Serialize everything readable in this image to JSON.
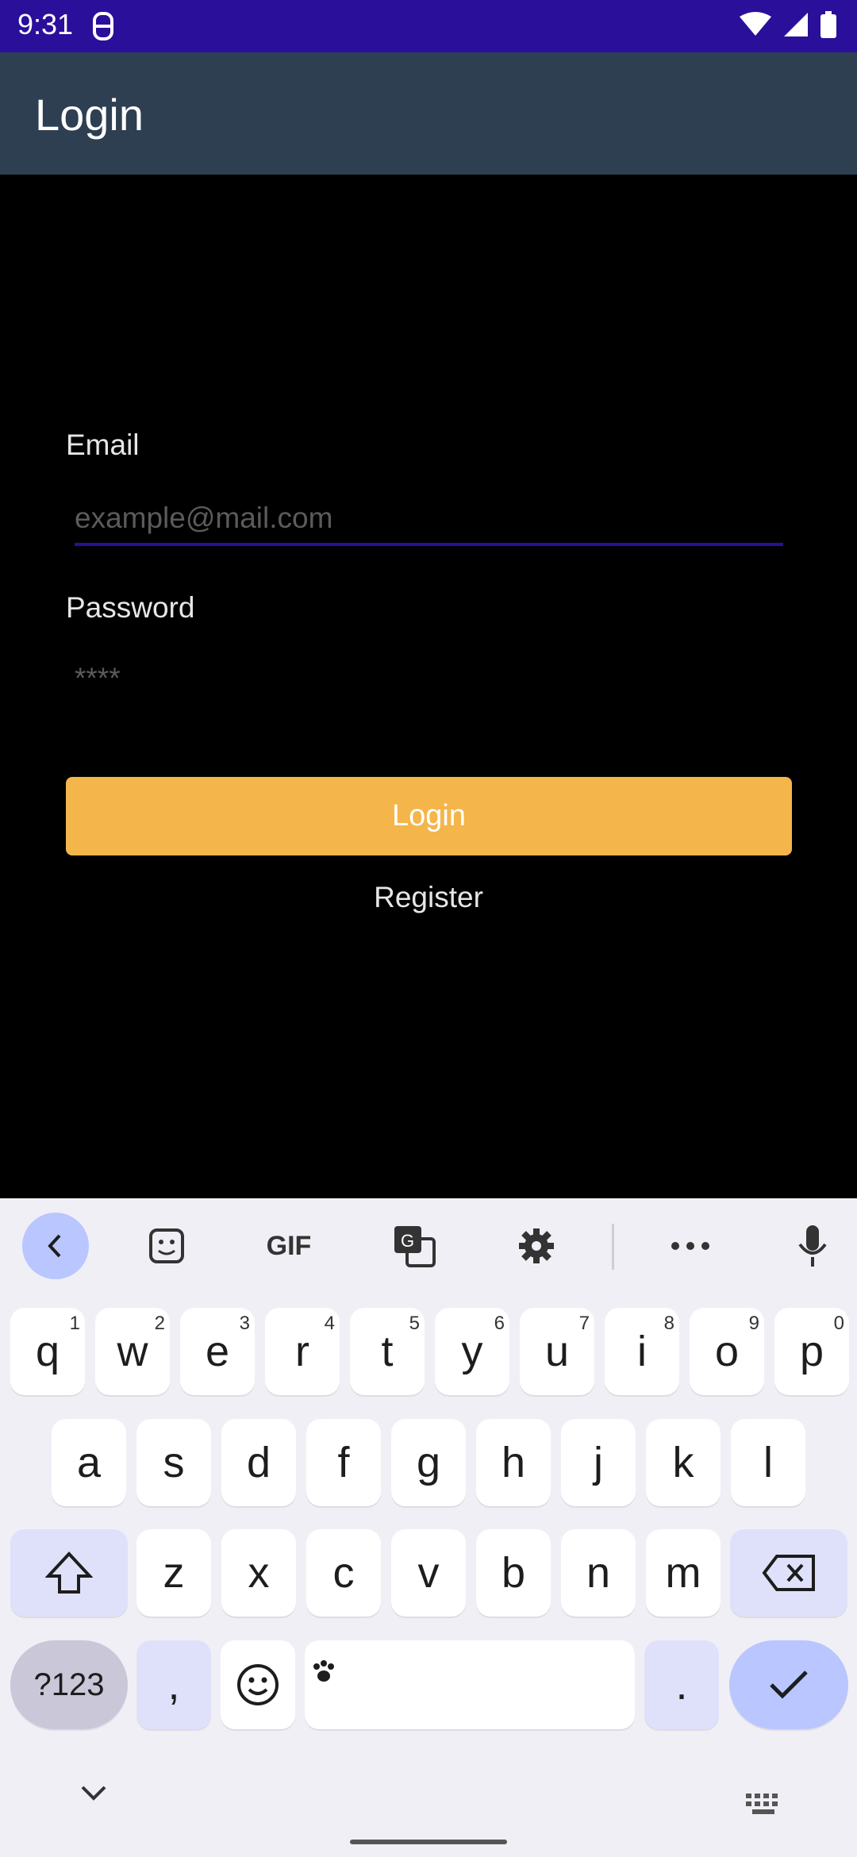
{
  "status_bar": {
    "time": "9:31"
  },
  "app_bar": {
    "title": "Login"
  },
  "form": {
    "email_label": "Email",
    "email_placeholder": "example@mail.com",
    "password_label": "Password",
    "password_placeholder": "****",
    "login_button": "Login",
    "register_link": "Register"
  },
  "colors": {
    "status_bar": "#2a0f9b",
    "app_bar": "#2e3f52",
    "accent_underline": "#2a0f9b",
    "login_button": "#f4b54a",
    "keyboard_bg": "#f1eff6"
  },
  "keyboard": {
    "toolbar_icons": [
      "back-icon",
      "sticker-icon",
      "gif-icon",
      "translate-icon",
      "gear-icon",
      "more-icon",
      "mic-icon"
    ],
    "gif_label": "GIF",
    "row1": [
      {
        "k": "q",
        "s": "1"
      },
      {
        "k": "w",
        "s": "2"
      },
      {
        "k": "e",
        "s": "3"
      },
      {
        "k": "r",
        "s": "4"
      },
      {
        "k": "t",
        "s": "5"
      },
      {
        "k": "y",
        "s": "6"
      },
      {
        "k": "u",
        "s": "7"
      },
      {
        "k": "i",
        "s": "8"
      },
      {
        "k": "o",
        "s": "9"
      },
      {
        "k": "p",
        "s": "0"
      }
    ],
    "row2": [
      "a",
      "s",
      "d",
      "f",
      "g",
      "h",
      "j",
      "k",
      "l"
    ],
    "row3": [
      "z",
      "x",
      "c",
      "v",
      "b",
      "n",
      "m"
    ],
    "numbers_key": "?123",
    "comma_key": ",",
    "period_key": "."
  }
}
